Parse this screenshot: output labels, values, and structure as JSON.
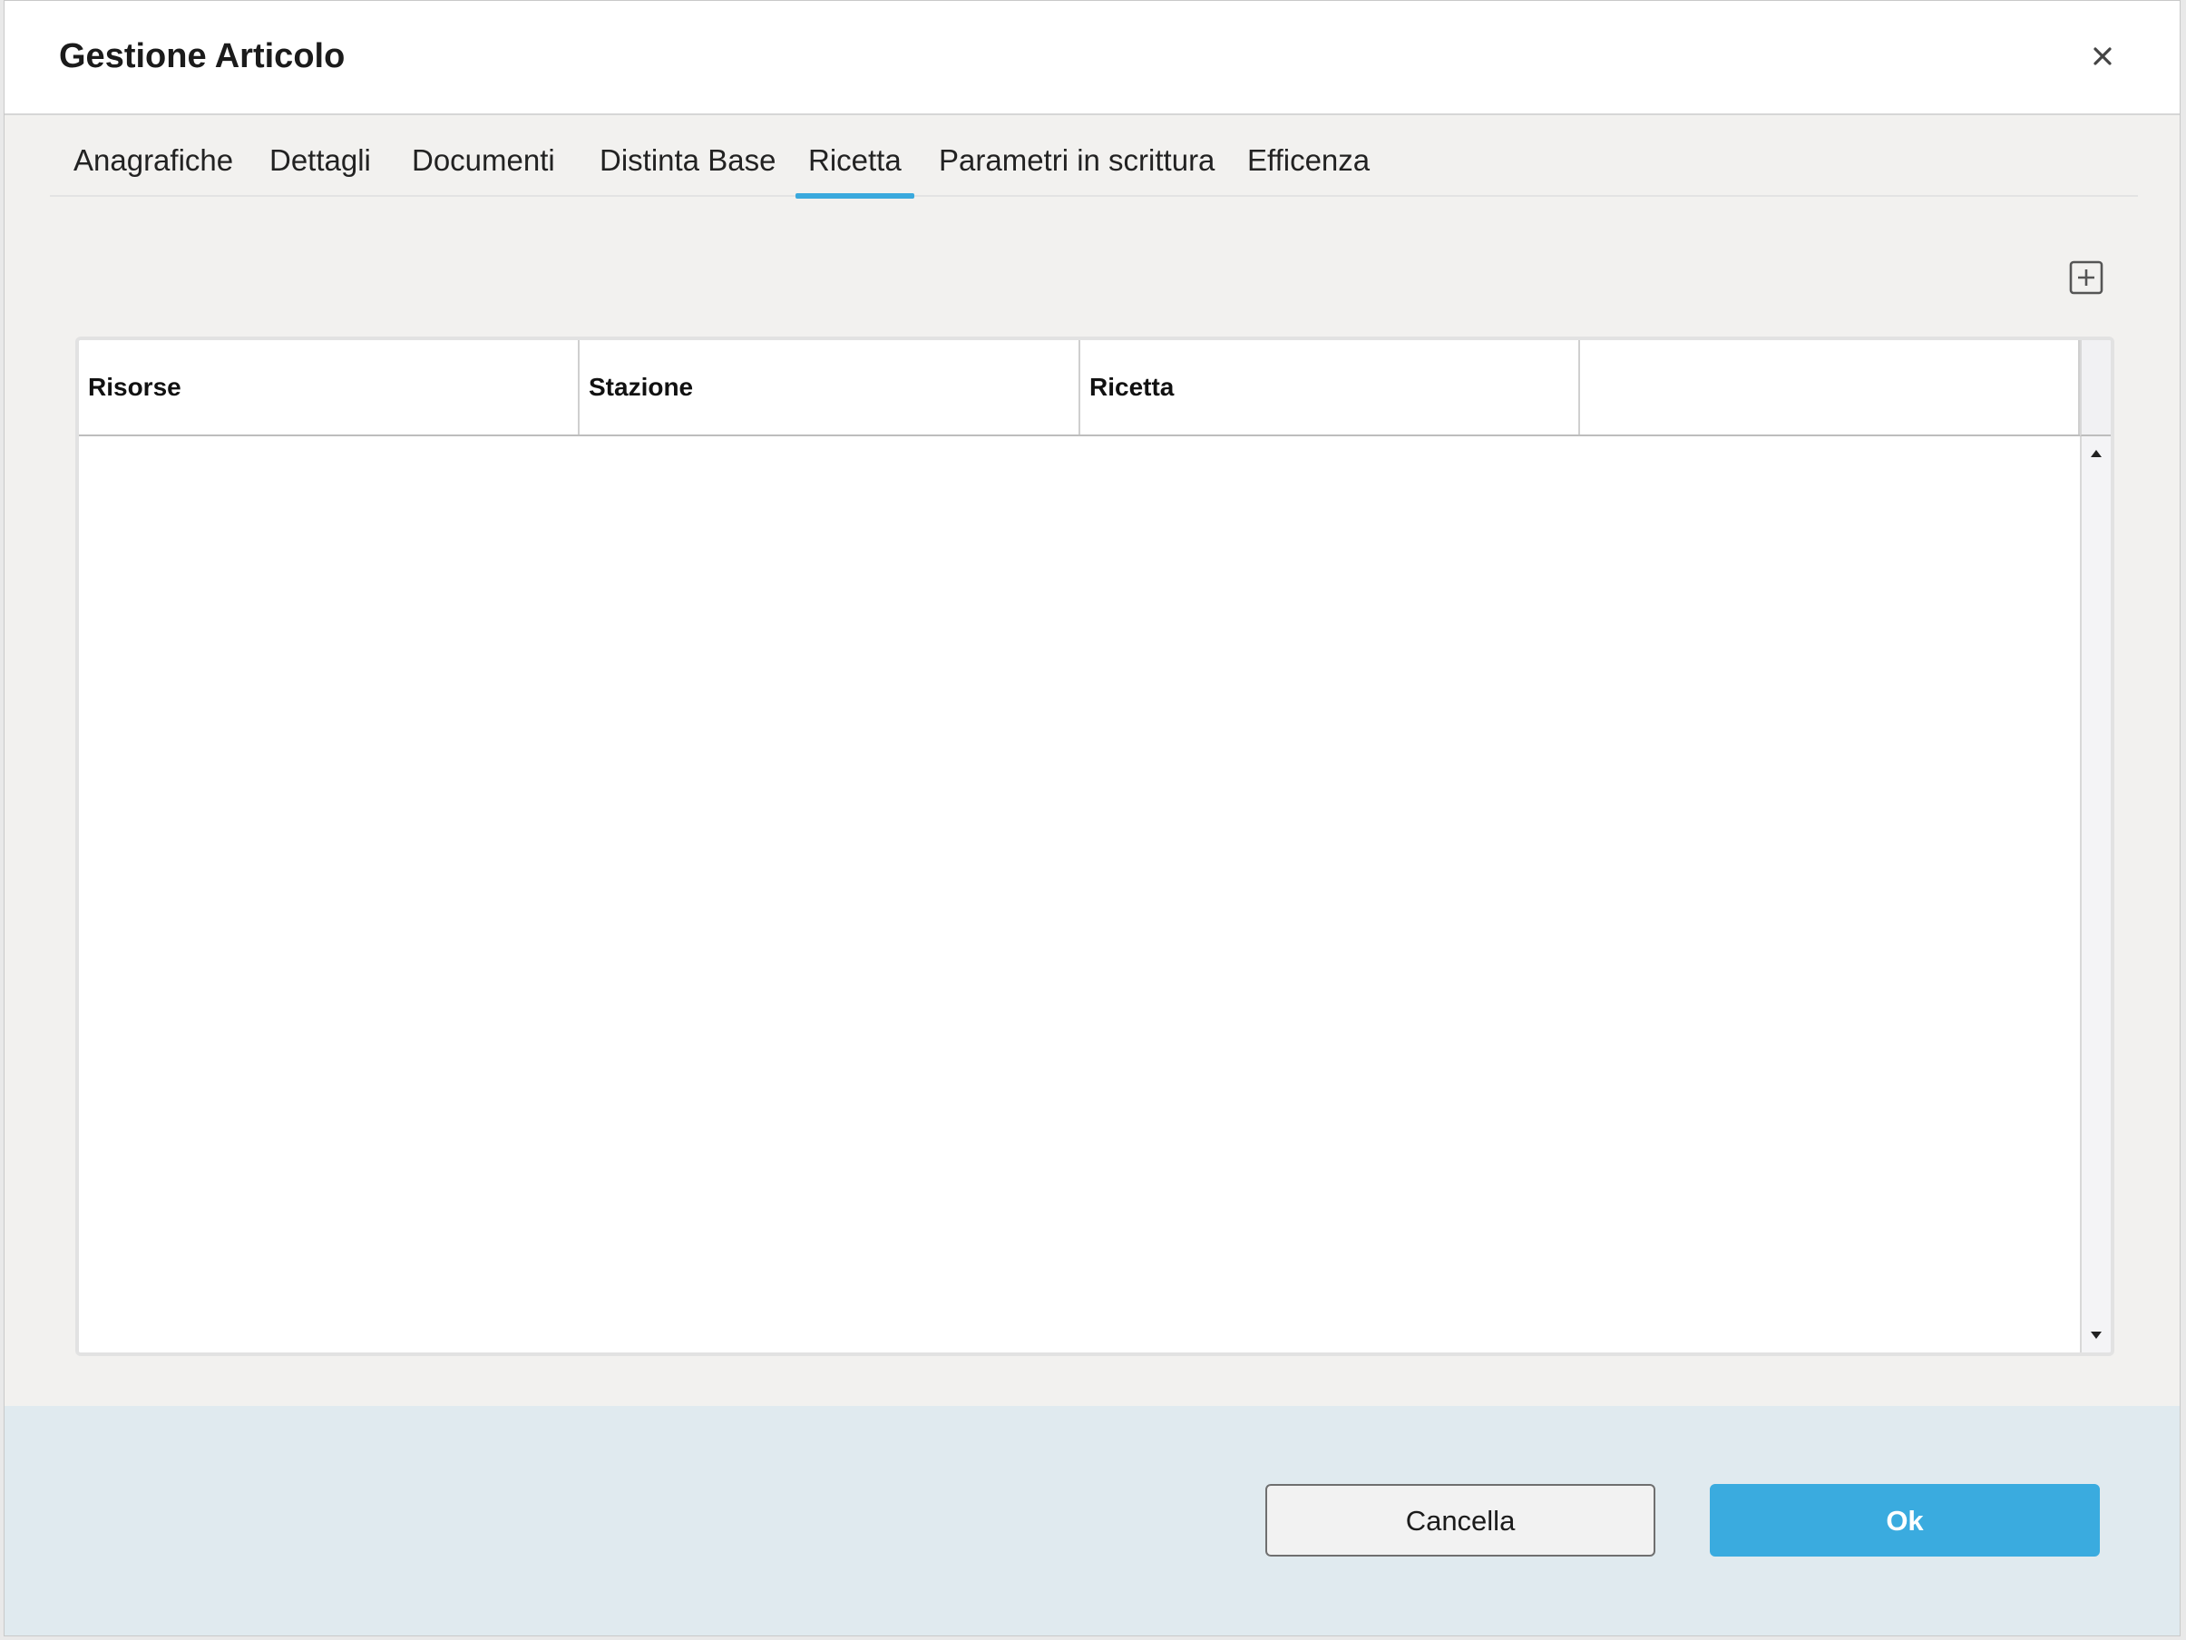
{
  "dialog": {
    "title": "Gestione Articolo"
  },
  "tabs": [
    {
      "label": "Anagrafiche"
    },
    {
      "label": "Dettagli"
    },
    {
      "label": "Documenti"
    },
    {
      "label": "Distinta Base"
    },
    {
      "label": "Ricetta",
      "active": true
    },
    {
      "label": "Parametri in scrittura"
    },
    {
      "label": "Efficenza"
    }
  ],
  "grid": {
    "columns": [
      "Risorse",
      "Stazione",
      "Ricetta",
      ""
    ],
    "rows": []
  },
  "footer": {
    "cancel_label": "Cancella",
    "ok_label": "Ok"
  },
  "colors": {
    "accent": "#3aabdf",
    "footer_bg": "#e0eaef",
    "dialog_bg": "#f2f1ef"
  },
  "icons": {
    "close": "close-icon",
    "add": "add-icon",
    "scroll_up": "scroll-up-arrow-icon",
    "scroll_down": "scroll-down-arrow-icon"
  }
}
